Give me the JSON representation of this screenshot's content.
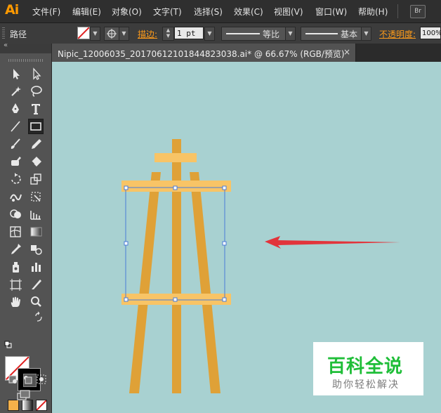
{
  "app": {
    "logo": "Ai",
    "bridge_badge": "Br"
  },
  "menu": [
    "文件(F)",
    "编辑(E)",
    "对象(O)",
    "文字(T)",
    "选择(S)",
    "效果(C)",
    "视图(V)",
    "窗口(W)",
    "帮助(H)"
  ],
  "control": {
    "selection_type": "路径",
    "stroke_label": "描边:",
    "stroke_weight": "1 pt",
    "profile_label": "等比",
    "brush_label": "基本",
    "opacity_label": "不透明度:",
    "opacity_value": "100%"
  },
  "document": {
    "tab_title": "Nipic_12006035_20170612101844823038.ai* @ 66.67% (RGB/预览)",
    "close": "×"
  },
  "toolbar": {
    "collapse": "«"
  },
  "colors": {
    "canvas_bg": "#a8d1d1",
    "easel": "#dfa137",
    "easel_light": "#f8c466",
    "selection": "#4a7bd8",
    "arrow": "#e2343b"
  },
  "watermark": {
    "title": "百科全说",
    "subtitle": "助你轻松解决"
  },
  "icons": [
    "selection-icon",
    "direct-selection-icon",
    "magic-wand-icon",
    "lasso-icon",
    "pen-icon",
    "type-icon",
    "line-icon",
    "rectangle-icon",
    "paintbrush-icon",
    "pencil-icon",
    "blob-brush-icon",
    "eraser-icon",
    "rotate-icon",
    "scale-icon",
    "warp-icon",
    "free-transform-icon",
    "shape-builder-icon",
    "perspective-icon",
    "mesh-icon",
    "gradient-icon",
    "eyedropper-icon",
    "blend-icon",
    "symbol-sprayer-icon",
    "column-graph-icon",
    "artboard-icon",
    "slice-icon",
    "hand-icon",
    "zoom-icon"
  ]
}
